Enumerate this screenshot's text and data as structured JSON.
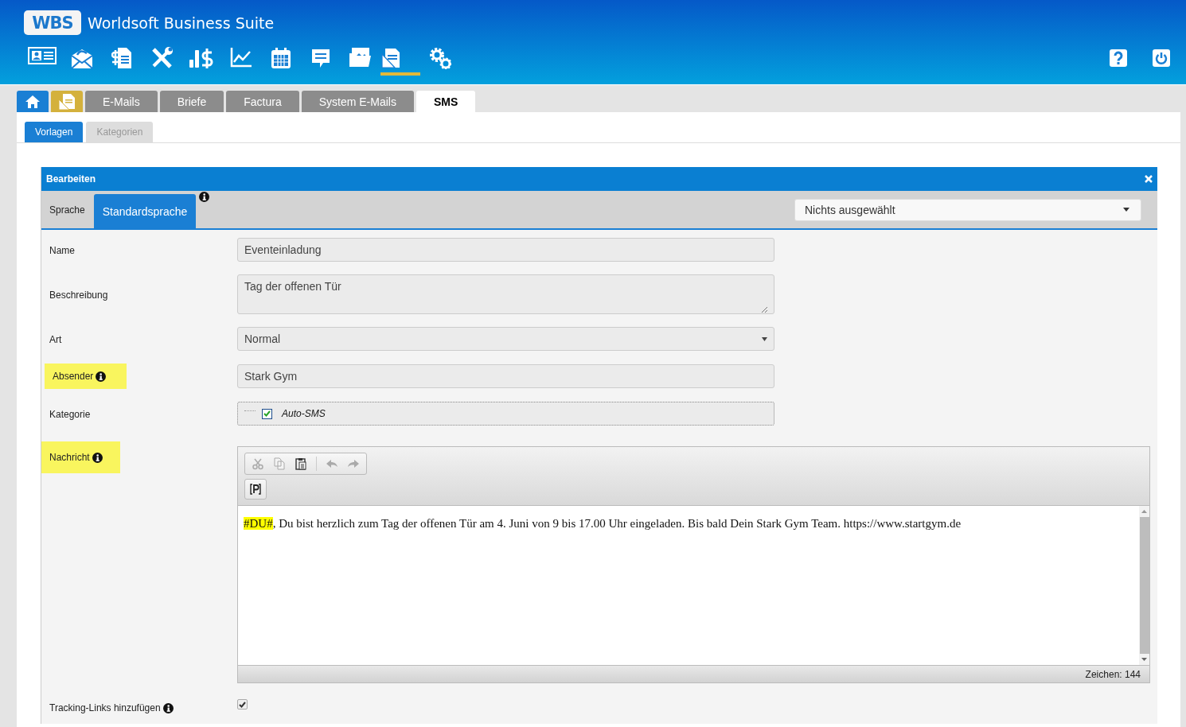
{
  "header": {
    "logo": "WBS",
    "title": "Worldsoft Business Suite",
    "toolbar": [
      {
        "kind": "contact-card",
        "selected": false
      },
      {
        "kind": "mail",
        "selected": false
      },
      {
        "kind": "invoice",
        "selected": false
      },
      {
        "kind": "tools",
        "selected": false
      },
      {
        "kind": "chart-dollar",
        "selected": false
      },
      {
        "kind": "line-chart",
        "selected": false
      },
      {
        "kind": "calendar",
        "selected": false
      },
      {
        "kind": "chat",
        "selected": false
      },
      {
        "kind": "images",
        "selected": false
      },
      {
        "kind": "document",
        "selected": true
      },
      {
        "kind": "gears",
        "selected": false
      }
    ],
    "actions": [
      {
        "kind": "help"
      },
      {
        "kind": "power"
      }
    ]
  },
  "tabs": [
    {
      "kind": "home",
      "selected": false
    },
    {
      "kind": "document",
      "selected": false
    },
    {
      "kind": "text",
      "label": "E-Mails",
      "selected": false
    },
    {
      "kind": "text",
      "label": "Briefe",
      "selected": false
    },
    {
      "kind": "text",
      "label": "Factura",
      "selected": false
    },
    {
      "kind": "text",
      "label": "System E-Mails",
      "selected": false
    },
    {
      "kind": "text",
      "label": "SMS",
      "selected": true
    }
  ],
  "subtabs": [
    {
      "label": "Vorlagen",
      "selected": true
    },
    {
      "label": "Kategorien",
      "selected": false
    }
  ],
  "panel": {
    "title": "Bearbeiten",
    "language_label": "Sprache",
    "language_tabs": [
      {
        "label": "Standardsprache",
        "selected": true
      }
    ],
    "language_info": true,
    "language_select": {
      "value": "Nichts ausgewählt"
    },
    "fields": [
      {
        "kind": "input",
        "label": "Name",
        "value": "Eventeinladung",
        "highlighted": false,
        "info": false
      },
      {
        "kind": "textarea",
        "label": "Beschreibung",
        "value": "Tag der offenen Tür",
        "highlighted": false,
        "info": false
      },
      {
        "kind": "select",
        "label": "Art",
        "value": "Normal",
        "highlighted": false,
        "info": false
      },
      {
        "kind": "input",
        "label": "Absender",
        "value": "Stark Gym",
        "highlighted": true,
        "info": true
      },
      {
        "kind": "tree",
        "label": "Kategorie",
        "items": [
          {
            "label": "Auto-SMS",
            "checked": true
          }
        ],
        "highlighted": false,
        "info": false
      },
      {
        "kind": "editor",
        "label": "Nachricht",
        "highlighted": true,
        "info": true,
        "message": {
          "tag": "#DU#",
          "text": ", Du bist herzlich zum Tag der offenen Tür am 4. Juni von 9 bis 17.00 Uhr eingeladen. Bis bald Dein Stark Gym Team. https://www.startgym.de"
        },
        "counter": "Zeichen: 144"
      },
      {
        "kind": "checkbox",
        "label": "Tracking-Links hinzufügen",
        "checked": true,
        "highlighted": false,
        "info": true
      }
    ]
  }
}
